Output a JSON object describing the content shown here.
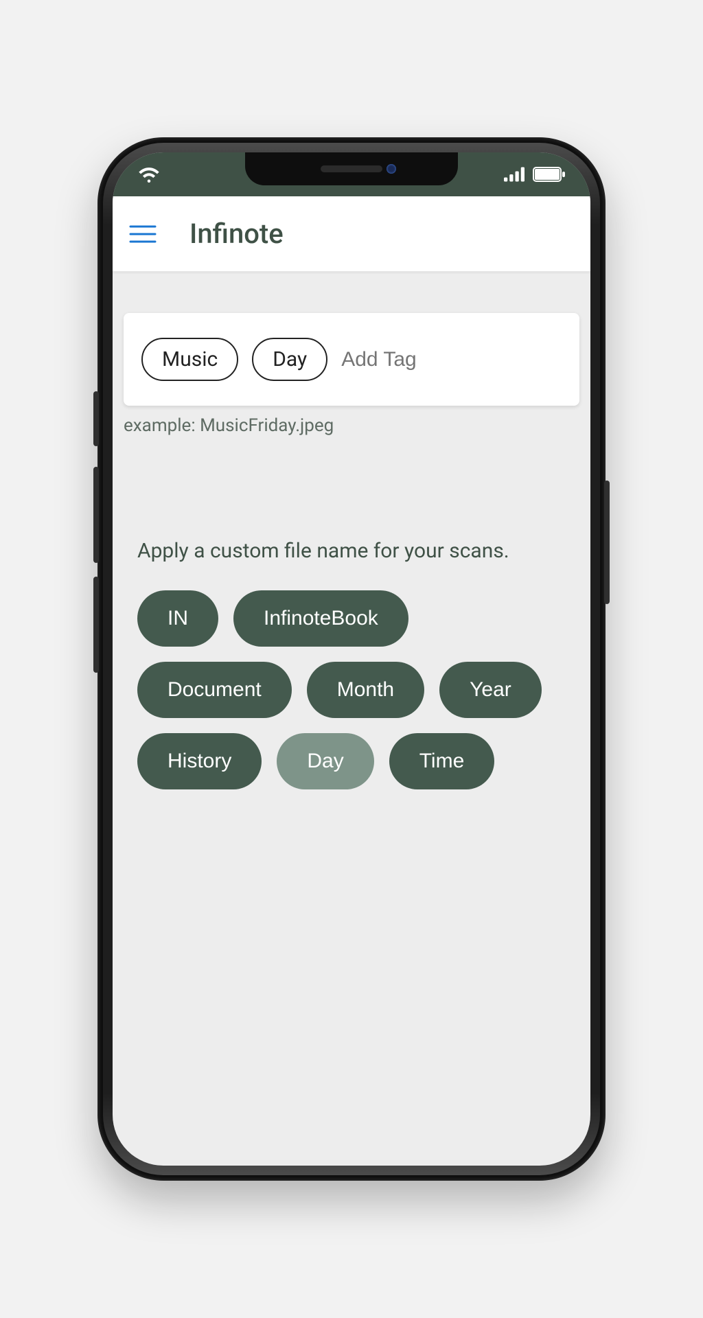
{
  "header": {
    "title": "Infinote"
  },
  "tagInput": {
    "tags": [
      "Music",
      "Day"
    ],
    "placeholder": "Add Tag"
  },
  "example_label": "example: MusicFriday.jpeg",
  "instruction": "Apply a custom file name for your scans.",
  "options": [
    {
      "label": "IN",
      "selected": false
    },
    {
      "label": "InfinoteBook",
      "selected": false
    },
    {
      "label": "Document",
      "selected": false
    },
    {
      "label": "Month",
      "selected": false
    },
    {
      "label": "Year",
      "selected": false
    },
    {
      "label": "History",
      "selected": false
    },
    {
      "label": "Day",
      "selected": true
    },
    {
      "label": "Time",
      "selected": false
    }
  ],
  "colors": {
    "brand_dark": "#445a4e",
    "brand_light": "#7e9489",
    "accent_blue": "#1976d2"
  }
}
